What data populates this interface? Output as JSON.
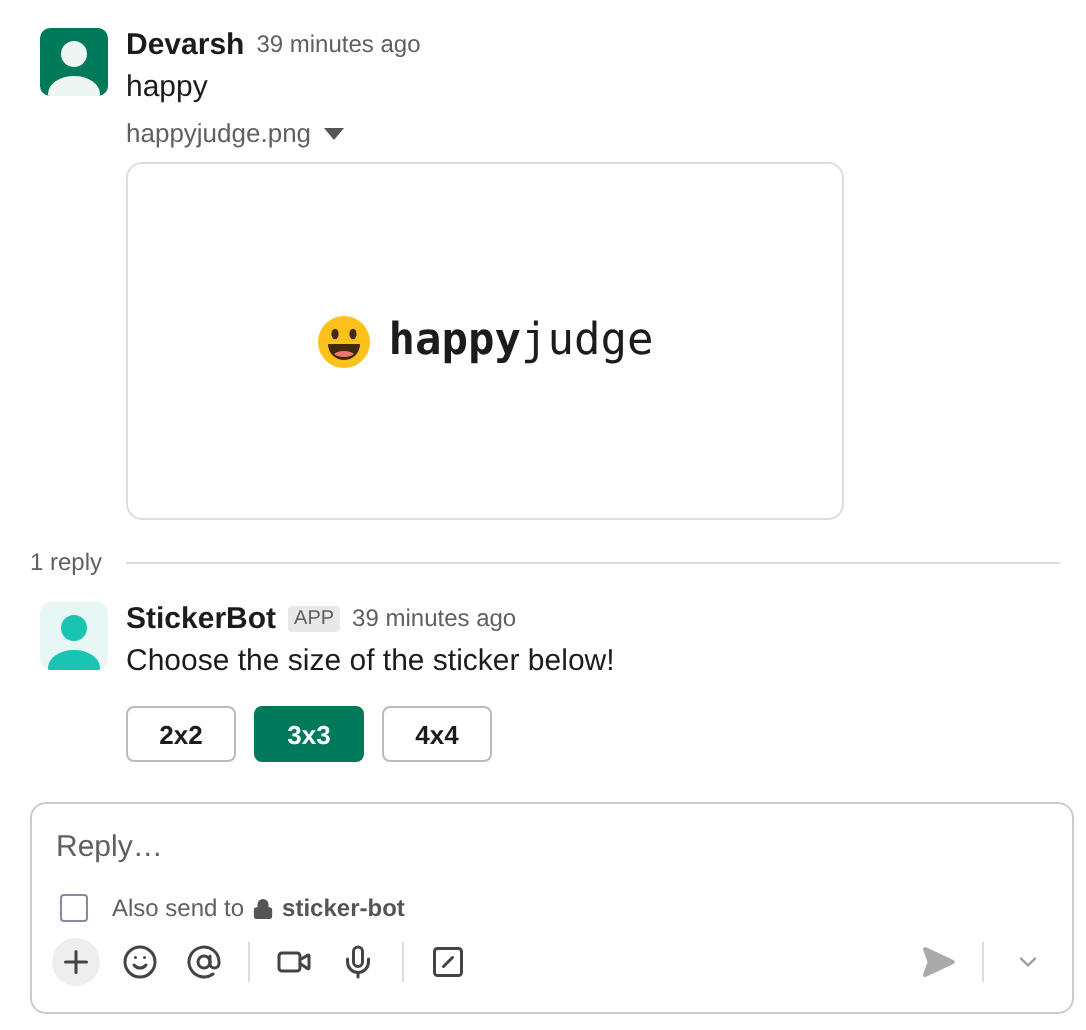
{
  "message": {
    "author": "Devarsh",
    "time": "39 minutes ago",
    "text": "happy",
    "attachment": {
      "filename": "happyjudge.png",
      "preview_text": "**happy**judge"
    }
  },
  "thread": {
    "reply_count": "1 reply"
  },
  "reply": {
    "author": "StickerBot",
    "badge": "APP",
    "time": "39 minutes ago",
    "text": "Choose the size of the sticker below!",
    "buttons": [
      {
        "label": "2x2",
        "selected": false
      },
      {
        "label": "3x3",
        "selected": true
      },
      {
        "label": "4x4",
        "selected": false
      }
    ]
  },
  "composer": {
    "placeholder": "Reply…",
    "also_send": {
      "label": "Also send to",
      "channel": "sticker-bot",
      "checked": false
    }
  }
}
